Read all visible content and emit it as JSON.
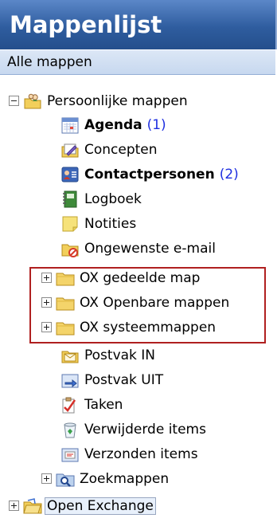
{
  "header": {
    "title": "Mappenlijst"
  },
  "subheader": {
    "label": "Alle mappen"
  },
  "tree": {
    "root": {
      "label": "Persoonlijke mappen",
      "expanded": true
    },
    "items": [
      {
        "label": "Agenda",
        "count": "(1)",
        "bold": true,
        "icon": "calendar-icon"
      },
      {
        "label": "Concepten",
        "icon": "drafts-icon"
      },
      {
        "label": "Contactpersonen",
        "count": "(2)",
        "bold": true,
        "icon": "contacts-icon"
      },
      {
        "label": "Logboek",
        "icon": "journal-icon"
      },
      {
        "label": "Notities",
        "icon": "notes-icon"
      },
      {
        "label": "Ongewenste e-mail",
        "icon": "junk-mail-icon"
      },
      {
        "label": "OX gedeelde map",
        "icon": "folder-icon",
        "expandable": true
      },
      {
        "label": "OX Openbare mappen",
        "icon": "folder-icon",
        "expandable": true
      },
      {
        "label": "OX systeemmappen",
        "icon": "folder-icon",
        "expandable": true
      },
      {
        "label": "Postvak IN",
        "icon": "inbox-icon"
      },
      {
        "label": "Postvak UIT",
        "icon": "outbox-icon"
      },
      {
        "label": "Taken",
        "icon": "tasks-icon"
      },
      {
        "label": "Verwijderde items",
        "icon": "deleted-items-icon"
      },
      {
        "label": "Verzonden items",
        "icon": "sent-items-icon"
      },
      {
        "label": "Zoekmappen",
        "icon": "search-folder-icon",
        "expandable": true
      }
    ],
    "bottom": {
      "label": "Open Exchange",
      "selected": true,
      "expandable": true
    }
  },
  "colors": {
    "header": "#2f5d9f",
    "highlight_border": "#b02020",
    "count": "#1f2fe0"
  }
}
